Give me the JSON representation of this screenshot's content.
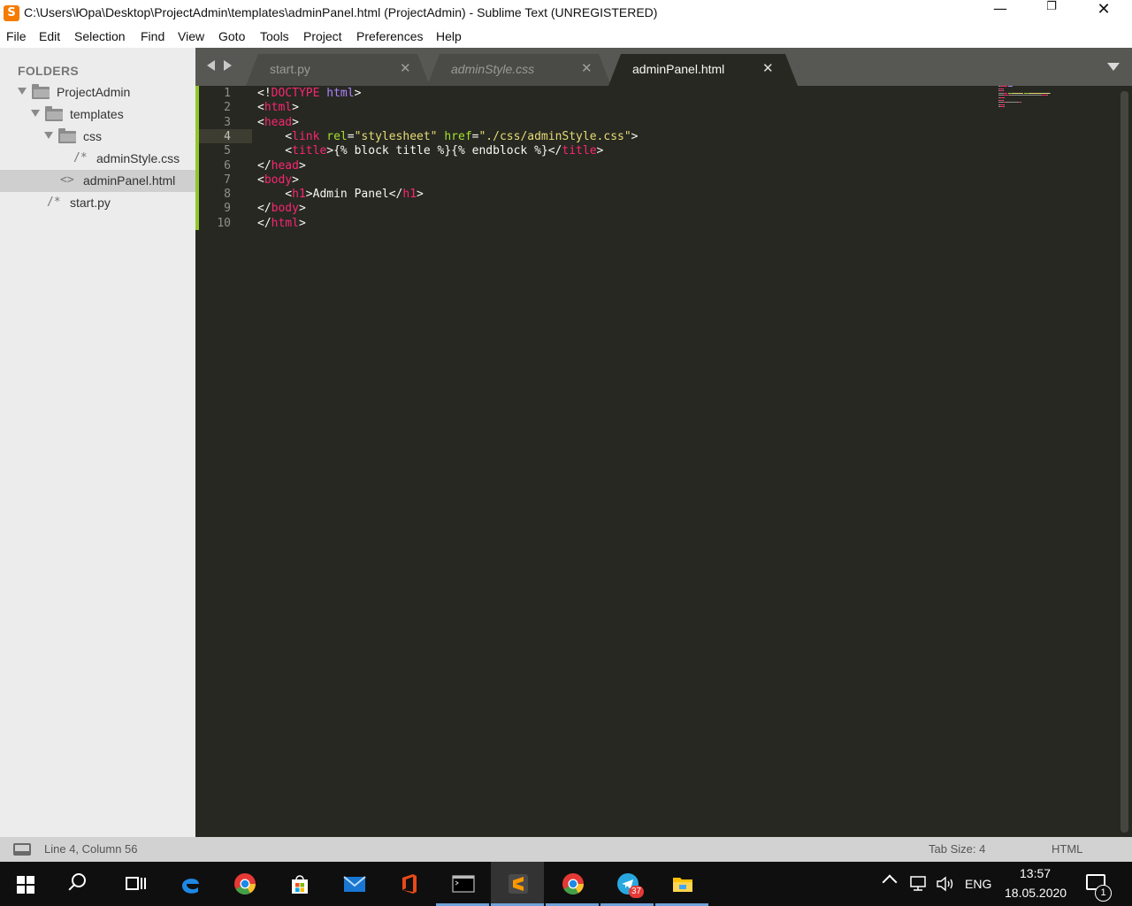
{
  "window": {
    "title": "C:\\Users\\Юра\\Desktop\\ProjectAdmin\\templates\\adminPanel.html (ProjectAdmin) - Sublime Text (UNREGISTERED)",
    "app_icon_letter": "S",
    "controls": {
      "minimize": "—",
      "maximize": "❐",
      "close": "✕"
    }
  },
  "menu": [
    "File",
    "Edit",
    "Selection",
    "Find",
    "View",
    "Goto",
    "Tools",
    "Project",
    "Preferences",
    "Help"
  ],
  "sidebar": {
    "header": "FOLDERS",
    "tree": [
      {
        "label": "ProjectAdmin",
        "kind": "folder",
        "expanded": true
      },
      {
        "label": "templates",
        "kind": "folder",
        "expanded": true
      },
      {
        "label": "css",
        "kind": "folder",
        "expanded": true
      },
      {
        "label": "adminStyle.css",
        "kind": "file",
        "glyph": "/*"
      },
      {
        "label": "adminPanel.html",
        "kind": "file",
        "glyph": "<>",
        "selected": true
      },
      {
        "label": "start.py",
        "kind": "file",
        "glyph": "/*"
      }
    ]
  },
  "tabs": [
    {
      "label": "start.py",
      "close": "✕",
      "active": false,
      "italic": false
    },
    {
      "label": "adminStyle.css",
      "close": "✕",
      "active": false,
      "italic": true
    },
    {
      "label": "adminPanel.html",
      "close": "✕",
      "active": true,
      "italic": false
    }
  ],
  "editor": {
    "current_line": 4,
    "lines": [
      {
        "num": "1",
        "tokens": [
          [
            "p",
            "<!"
          ],
          [
            "tag",
            "DOCTYPE"
          ],
          [
            "p",
            " "
          ],
          [
            "kw",
            "html"
          ],
          [
            "p",
            ">"
          ]
        ]
      },
      {
        "num": "2",
        "tokens": [
          [
            "p",
            "<"
          ],
          [
            "tag",
            "html"
          ],
          [
            "p",
            ">"
          ]
        ]
      },
      {
        "num": "3",
        "tokens": [
          [
            "p",
            "<"
          ],
          [
            "tag",
            "head"
          ],
          [
            "p",
            ">"
          ]
        ]
      },
      {
        "num": "4",
        "tokens": [
          [
            "p",
            "    <"
          ],
          [
            "tag",
            "link"
          ],
          [
            "p",
            " "
          ],
          [
            "attr",
            "rel"
          ],
          [
            "p",
            "="
          ],
          [
            "str",
            "\"stylesheet\""
          ],
          [
            "p",
            " "
          ],
          [
            "attr",
            "href"
          ],
          [
            "p",
            "="
          ],
          [
            "str",
            "\"./css/adminStyle.css\""
          ],
          [
            "p",
            ">"
          ]
        ]
      },
      {
        "num": "5",
        "tokens": [
          [
            "p",
            "    <"
          ],
          [
            "tag",
            "title"
          ],
          [
            "p",
            ">{% block title %}{% endblock %}</"
          ],
          [
            "tag",
            "title"
          ],
          [
            "p",
            ">"
          ]
        ]
      },
      {
        "num": "6",
        "tokens": [
          [
            "p",
            "</"
          ],
          [
            "tag",
            "head"
          ],
          [
            "p",
            ">"
          ]
        ]
      },
      {
        "num": "7",
        "tokens": [
          [
            "p",
            "<"
          ],
          [
            "tag",
            "body"
          ],
          [
            "p",
            ">"
          ]
        ]
      },
      {
        "num": "8",
        "tokens": [
          [
            "p",
            "    <"
          ],
          [
            "tag",
            "h1"
          ],
          [
            "p",
            ">Admin Panel</"
          ],
          [
            "tag",
            "h1"
          ],
          [
            "p",
            ">"
          ]
        ]
      },
      {
        "num": "9",
        "tokens": [
          [
            "p",
            "</"
          ],
          [
            "tag",
            "body"
          ],
          [
            "p",
            ">"
          ]
        ]
      },
      {
        "num": "10",
        "tokens": [
          [
            "p",
            "</"
          ],
          [
            "tag",
            "html"
          ],
          [
            "p",
            ">"
          ]
        ]
      }
    ]
  },
  "statusbar": {
    "position": "Line 4, Column 56",
    "tab_size": "Tab Size: 4",
    "syntax": "HTML"
  },
  "taskbar": {
    "apps": [
      {
        "name": "windows-start-icon",
        "running": false
      },
      {
        "name": "search-icon",
        "running": false
      },
      {
        "name": "task-view-icon",
        "running": false
      },
      {
        "name": "edge-icon",
        "running": false
      },
      {
        "name": "chrome-icon",
        "running": false
      },
      {
        "name": "store-icon",
        "running": false
      },
      {
        "name": "mail-icon",
        "running": false
      },
      {
        "name": "office-icon",
        "running": false
      },
      {
        "name": "terminal-icon",
        "running": true
      },
      {
        "name": "sublime-icon",
        "running": true,
        "active": true
      },
      {
        "name": "chrome-icon",
        "running": true
      },
      {
        "name": "telegram-icon",
        "running": true,
        "badge": "37"
      },
      {
        "name": "file-explorer-icon",
        "running": true
      }
    ],
    "tray": {
      "language": "ENG",
      "time": "13:57",
      "date": "18.05.2020",
      "notifications": "1"
    }
  },
  "colors": {
    "editor_bg": "#272822",
    "tag": "#f92672",
    "attr": "#a6e22e",
    "string": "#e6db74",
    "keyword": "#ae81ff",
    "sidebar_bg": "#ececec",
    "tabbar_bg": "#575853"
  }
}
